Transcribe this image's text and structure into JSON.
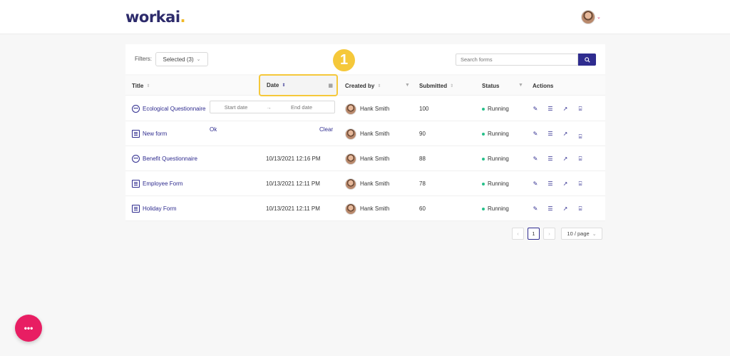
{
  "app": {
    "logo_text": "workai",
    "logo_dot": "."
  },
  "header": {
    "avatar_icon": "user-avatar",
    "menu_caret": "⌄"
  },
  "filters": {
    "label": "Filters:",
    "selected": "Selected (3)",
    "search_placeholder": "Search forms"
  },
  "table": {
    "columns": {
      "title": "Title",
      "date": "Date",
      "created_by": "Created by",
      "submitted": "Submitted",
      "status": "Status",
      "actions": "Actions"
    },
    "rows": [
      {
        "title": "Ecological Questionnaire",
        "type": "questionnaire",
        "date": "",
        "created_by": "Hank Smith",
        "submitted": "100",
        "status": "Running"
      },
      {
        "title": "New form",
        "type": "form",
        "date": "",
        "created_by": "Hank Smith",
        "submitted": "90",
        "status": "Running"
      },
      {
        "title": "Benefit Questionnaire",
        "type": "questionnaire",
        "date": "10/13/2021 12:16 PM",
        "created_by": "Hank Smith",
        "submitted": "88",
        "status": "Running"
      },
      {
        "title": "Employee Form",
        "type": "form",
        "date": "10/13/2021 12:11 PM",
        "created_by": "Hank Smith",
        "submitted": "78",
        "status": "Running"
      },
      {
        "title": "Holiday Form",
        "type": "form",
        "date": "10/13/2021 12:11 PM",
        "created_by": "Hank Smith",
        "submitted": "60",
        "status": "Running"
      }
    ]
  },
  "date_filter": {
    "start_placeholder": "Start date",
    "end_placeholder": "End date",
    "separator": "→",
    "ok": "Ok",
    "clear": "Clear"
  },
  "step_badge": "1",
  "pagination": {
    "prev": "‹",
    "current": "1",
    "next": "›",
    "page_size": "10 / page"
  },
  "fab": {
    "label": "•••"
  },
  "colors": {
    "brand": "#2f2c8f",
    "accent": "#f5c83a",
    "fab": "#e81e63",
    "status_running": "#27c08a"
  }
}
